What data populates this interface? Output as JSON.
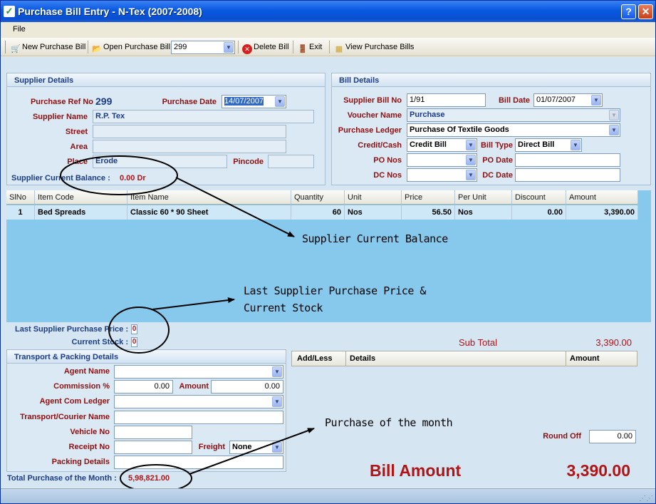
{
  "window": {
    "title": "Purchase Bill Entry - N-Tex (2007-2008)",
    "help": "?",
    "close": "✕"
  },
  "menu": {
    "file": "File"
  },
  "toolbar": {
    "new_bill": "New Purchase Bill",
    "open_bill": "Open Purchase Bill",
    "bill_no": "299",
    "delete_bill": "Delete Bill",
    "exit": "Exit",
    "view_bills": "View Purchase Bills"
  },
  "supplier": {
    "header": "Supplier Details",
    "ref_label": "Purchase Ref No",
    "ref_value": "299",
    "date_label": "Purchase Date",
    "date_value": "14/07/2007",
    "name_label": "Supplier Name",
    "name_value": "R.P. Tex",
    "street_label": "Street",
    "street_value": "",
    "area_label": "Area",
    "area_value": "",
    "place_label": "Place",
    "place_value": "Erode",
    "pincode_label": "Pincode",
    "pincode_value": "",
    "balance_label": "Supplier Current Balance :",
    "balance_value": "0.00 Dr"
  },
  "bill": {
    "header": "Bill Details",
    "bill_no_label": "Supplier Bill No",
    "bill_no_value": "1/91",
    "bill_date_label": "Bill Date",
    "bill_date_value": "01/07/2007",
    "voucher_label": "Voucher Name",
    "voucher_value": "Purchase",
    "ledger_label": "Purchase Ledger",
    "ledger_value": "Purchase Of Textile Goods",
    "credit_label": "Credit/Cash",
    "credit_value": "Credit Bill",
    "type_label": "Bill Type",
    "type_value": "Direct Bill",
    "po_nos_label": "PO Nos",
    "po_nos_value": "",
    "po_date_label": "PO Date",
    "po_date_value": "",
    "dc_nos_label": "DC Nos",
    "dc_nos_value": "",
    "dc_date_label": "DC Date",
    "dc_date_value": ""
  },
  "items": {
    "columns": [
      "SlNo",
      "Item Code",
      "Item Name",
      "Quantity",
      "Unit",
      "Price",
      "Per Unit",
      "Discount",
      "Amount"
    ],
    "rows": [
      [
        "1",
        "Bed Spreads",
        "Classic 60 * 90 Sheet",
        "60",
        "Nos",
        "56.50",
        "Nos",
        "0.00",
        "3,390.00"
      ]
    ]
  },
  "stock": {
    "last_price_label": "Last Supplier Purchase Price :",
    "last_price_value": "0",
    "current_stock_label": "Current Stock :",
    "current_stock_value": "0"
  },
  "transport": {
    "header": "Transport & Packing Details",
    "agent_label": "Agent Name",
    "agent_value": "",
    "commission_label": "Commission %",
    "commission_value": "0.00",
    "amount_label": "Amount",
    "amount_value": "0.00",
    "agent_ledger_label": "Agent Com Ledger",
    "agent_ledger_value": "",
    "courier_label": "Transport/Courier Name",
    "courier_value": "",
    "vehicle_label": "Vehicle No",
    "vehicle_value": "",
    "receipt_label": "Receipt No",
    "receipt_value": "",
    "freight_label": "Freight",
    "freight_value": "None",
    "packing_label": "Packing Details",
    "packing_value": ""
  },
  "month_total": {
    "label": "Total Purchase of the Month :",
    "value": "5,98,821.00"
  },
  "totals": {
    "subtotal_label": "Sub Total",
    "subtotal_value": "3,390.00",
    "addless_columns": [
      "Add/Less",
      "Details",
      "Amount"
    ],
    "roundoff_label": "Round Off",
    "roundoff_value": "0.00",
    "bill_amount_label": "Bill Amount",
    "bill_amount_value": "3,390.00"
  },
  "annotations": {
    "balance": "Supplier Current Balance",
    "price_stock_1": "Last Supplier Purchase Price &",
    "price_stock_2": "Current Stock",
    "month": "Purchase of the month"
  },
  "colors": {
    "label_red": "#8c1010",
    "label_blue": "#1b3d87",
    "grid_bg": "#87c9ec",
    "bill_amount": "#b01414"
  }
}
